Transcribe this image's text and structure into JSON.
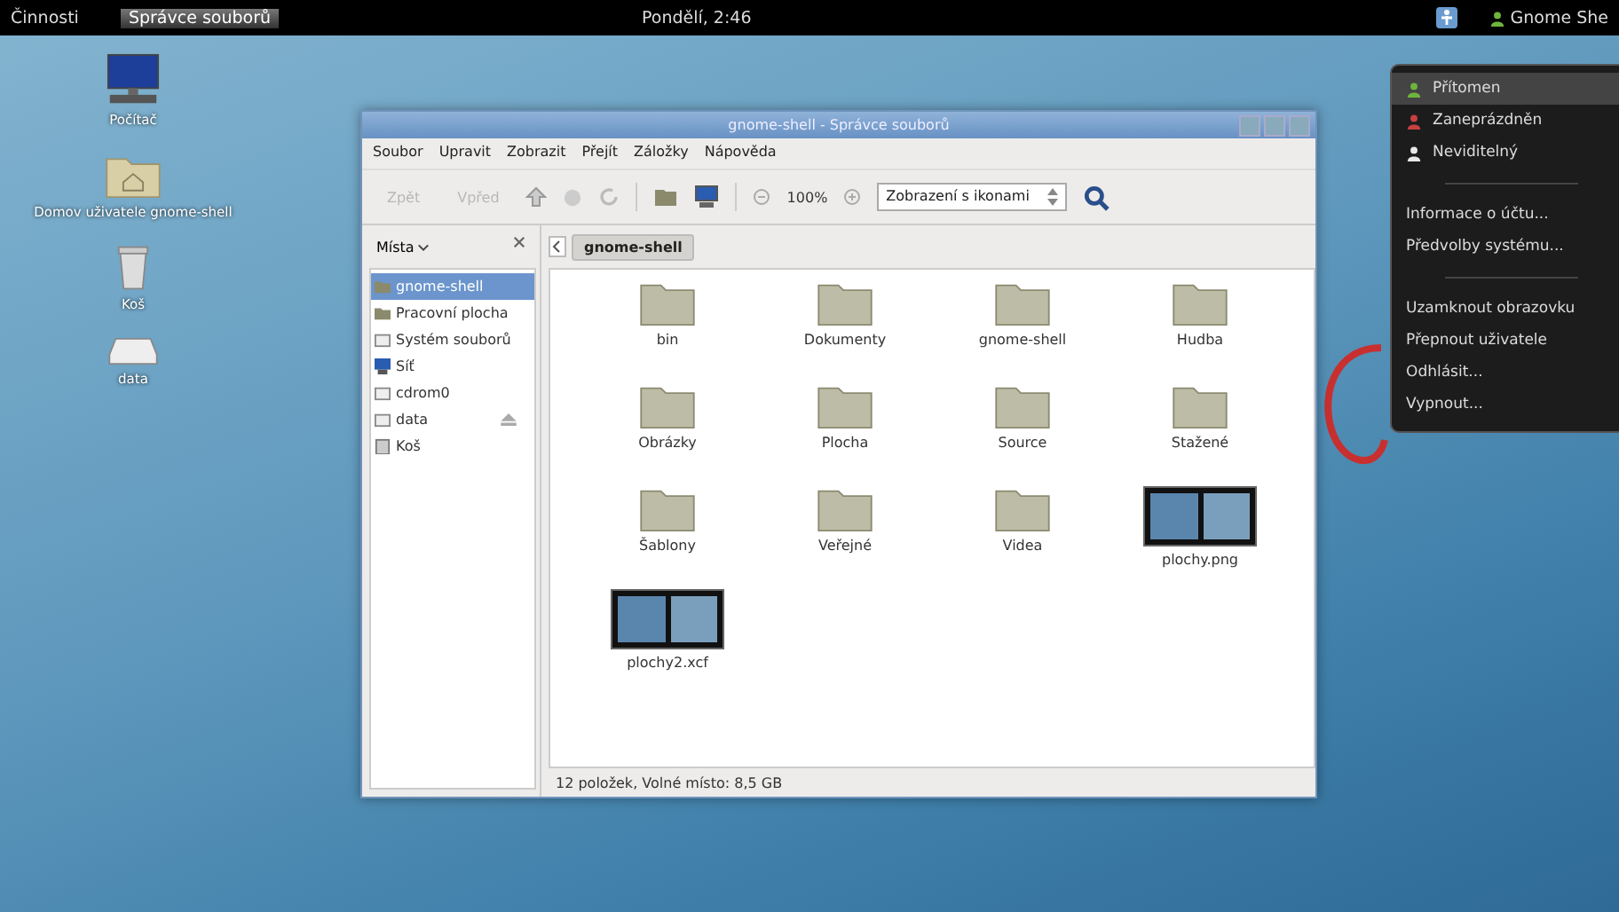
{
  "top_bar": {
    "activities": "Činnosti",
    "app_name": "Správce souborů",
    "clock": "Pondělí, 2:46",
    "user": "Gnome She"
  },
  "desktop_icons": [
    {
      "kind": "computer",
      "label": "Počítač"
    },
    {
      "kind": "home",
      "label": "Domov uživatele gnome-shell"
    },
    {
      "kind": "trash",
      "label": "Koš"
    },
    {
      "kind": "drive",
      "label": "data"
    }
  ],
  "window": {
    "title": "gnome-shell - Správce souborů",
    "menu": [
      "Soubor",
      "Upravit",
      "Zobrazit",
      "Přejít",
      "Záložky",
      "Nápověda"
    ],
    "toolbar": {
      "back": {
        "label": "Zpět",
        "disabled": true
      },
      "forward": {
        "label": "Vpřed",
        "disabled": true
      },
      "zoom": "100%",
      "view_select": "Zobrazení s ikonami"
    },
    "sidebar": {
      "header": "Místa",
      "items": [
        {
          "kind": "home",
          "label": "gnome-shell",
          "selected": true
        },
        {
          "kind": "desktop",
          "label": "Pracovní plocha",
          "selected": false
        },
        {
          "kind": "drive",
          "label": "Systém souborů",
          "selected": false
        },
        {
          "kind": "network",
          "label": "Síť",
          "selected": false
        },
        {
          "kind": "drive",
          "label": "cdrom0",
          "selected": false
        },
        {
          "kind": "drive",
          "label": "data",
          "selected": false,
          "eject": true
        },
        {
          "kind": "trash",
          "label": "Koš",
          "selected": false
        }
      ]
    },
    "path": "gnome-shell",
    "files": [
      {
        "kind": "folder",
        "name": "bin"
      },
      {
        "kind": "folder",
        "name": "Dokumenty"
      },
      {
        "kind": "folder",
        "name": "gnome-shell"
      },
      {
        "kind": "folder",
        "name": "Hudba"
      },
      {
        "kind": "folder",
        "name": "Obrázky"
      },
      {
        "kind": "folder",
        "name": "Plocha"
      },
      {
        "kind": "folder",
        "name": "Source"
      },
      {
        "kind": "folder",
        "name": "Stažené"
      },
      {
        "kind": "folder",
        "name": "Šablony"
      },
      {
        "kind": "folder",
        "name": "Veřejné"
      },
      {
        "kind": "folder",
        "name": "Videa"
      },
      {
        "kind": "image",
        "name": "plochy.png"
      },
      {
        "kind": "image",
        "name": "plochy2.xcf"
      }
    ],
    "status": "12 položek, Volné místo: 8,5 GB"
  },
  "user_menu": {
    "statuses": [
      {
        "label": "Přítomen",
        "selected": true
      },
      {
        "label": "Zaneprázdněn",
        "selected": false
      },
      {
        "label": "Neviditelný",
        "selected": false
      }
    ],
    "groups": [
      [
        "Informace o účtu...",
        "Předvolby systému..."
      ],
      [
        "Uzamknout obrazovku",
        "Přepnout uživatele",
        "Odhlásit...",
        "Vypnout..."
      ]
    ]
  }
}
